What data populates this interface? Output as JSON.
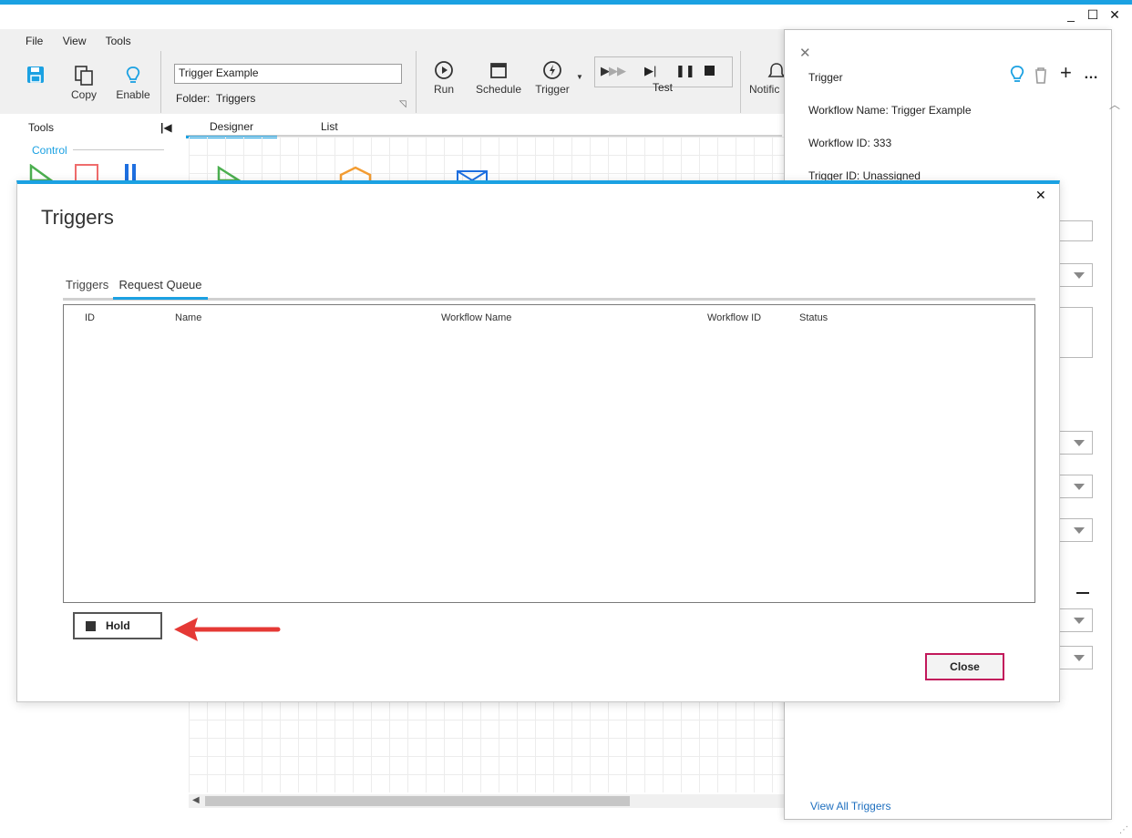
{
  "window": {
    "minimize": "_",
    "maximize": "☐",
    "close": "✕"
  },
  "menu": [
    "File",
    "View",
    "Tools"
  ],
  "ribbon": {
    "save_label": "",
    "copy_label": "Copy",
    "enable_label": "Enable",
    "workflow_name_value": "Trigger Example",
    "folder_label": "Folder:",
    "folder_value": "Triggers",
    "run_label": "Run",
    "schedule_label": "Schedule",
    "trigger_label": "Trigger",
    "test_label": "Test",
    "notifications_label": "Notific"
  },
  "tools_panel": {
    "title": "Tools",
    "section": "Control"
  },
  "designer_tabs": [
    "Designer",
    "List"
  ],
  "right_panel": {
    "title": "Trigger",
    "workflow_name": "Workflow Name: Trigger Example",
    "workflow_id": "Workflow ID: 333",
    "trigger_id": "Trigger ID: Unassigned",
    "view_all_link": "View All Triggers"
  },
  "dialog": {
    "title": "Triggers",
    "tabs": [
      "Triggers",
      "Request Queue"
    ],
    "active_tab": "Request Queue",
    "columns": [
      "ID",
      "Name",
      "Workflow Name",
      "Workflow ID",
      "Status"
    ],
    "rows": [],
    "hold_label": "Hold",
    "close_label": "Close"
  },
  "colors": {
    "accent": "#1ba1e2",
    "close_border": "#c2185b",
    "arrow": "#e53935"
  }
}
